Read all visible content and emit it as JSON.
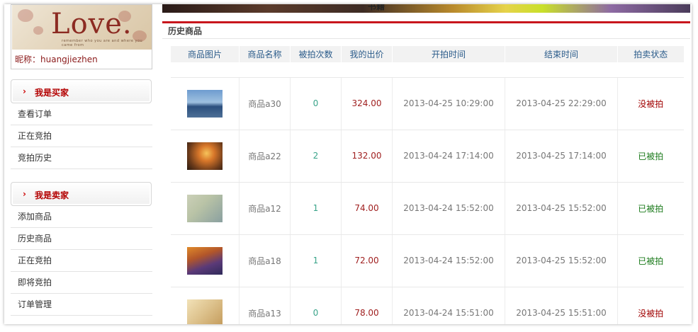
{
  "sidebar": {
    "profile": {
      "banner_word": "Love.",
      "banner_subtext": "remember who you are and where you came from",
      "nickname_label": "昵称：",
      "nickname_value": "huangjiezhen"
    },
    "buyer": {
      "title": "我是买家",
      "items": [
        "查看订单",
        "正在竞拍",
        "竞拍历史"
      ]
    },
    "seller": {
      "title": "我是卖家",
      "items": [
        "添加商品",
        "历史商品",
        "正在竞拍",
        "即将竞拍",
        "订单管理"
      ]
    }
  },
  "main": {
    "banner_text": "书籍",
    "section_title": "历史商品",
    "columns": [
      "商品图片",
      "商品名称",
      "被拍次数",
      "我的出价",
      "开拍时间",
      "结束时间",
      "拍卖状态"
    ],
    "rows": [
      {
        "thumb": "sea-sky-thumbnail",
        "name": "商品a30",
        "count": "0",
        "price": "324.00",
        "start": "2013-04-25 10:29:00",
        "end": "2013-04-25 22:29:00",
        "status": "没被拍",
        "status_kind": "none"
      },
      {
        "thumb": "sunset-thumbnail",
        "name": "商品a22",
        "count": "2",
        "price": "132.00",
        "start": "2013-04-24 17:14:00",
        "end": "2013-04-25 17:14:00",
        "status": "已被拍",
        "status_kind": "done"
      },
      {
        "thumb": "crayons-thumbnail",
        "name": "商品a12",
        "count": "1",
        "price": "74.00",
        "start": "2013-04-24 15:52:00",
        "end": "2013-04-25 15:52:00",
        "status": "已被拍",
        "status_kind": "done"
      },
      {
        "thumb": "fabric-thumbnail",
        "name": "商品a18",
        "count": "1",
        "price": "72.00",
        "start": "2013-04-24 15:52:00",
        "end": "2013-04-25 15:52:00",
        "status": "已被拍",
        "status_kind": "done"
      },
      {
        "thumb": "gift-thumbnail",
        "name": "商品a13",
        "count": "0",
        "price": "78.00",
        "start": "2013-04-24 15:51:00",
        "end": "2013-04-25 15:51:00",
        "status": "没被拍",
        "status_kind": "none"
      }
    ]
  },
  "colors": {
    "accent_red": "#c8161d",
    "menu_title": "#b30000",
    "header_text": "#2a5b8a",
    "status_none": "#a00000",
    "status_done": "#1a7a1a"
  }
}
